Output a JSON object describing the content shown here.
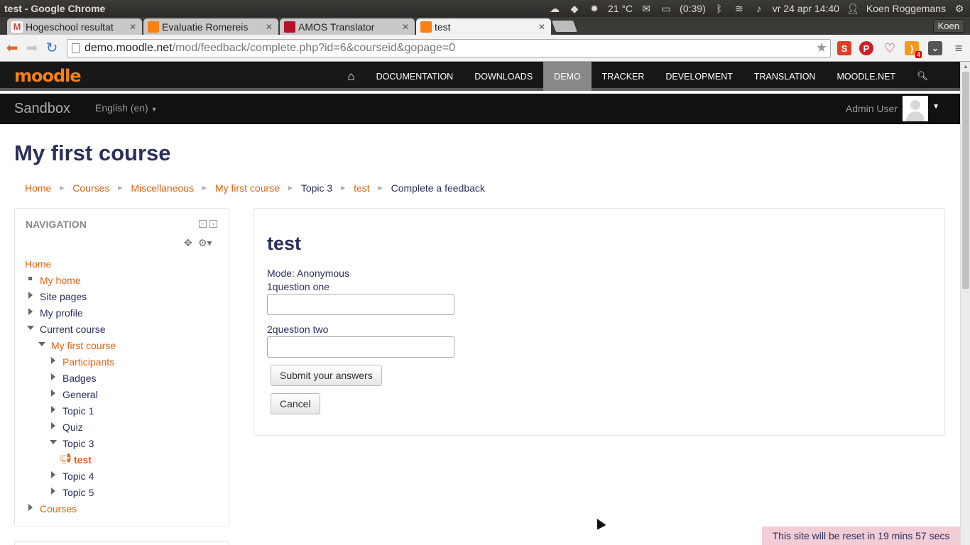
{
  "os_panel": {
    "window_title": "test - Google Chrome",
    "weather": "21 °C",
    "battery": "(0:39)",
    "datetime": "vr 24 apr 14:40",
    "user": "Koen Roggemans"
  },
  "browser": {
    "tabs": [
      {
        "label": "Hogeschool resultat",
        "favicon_color": "#d73b2f",
        "active": false
      },
      {
        "label": "Evaluatie Romereis",
        "favicon_color": "#f98012",
        "active": false
      },
      {
        "label": "AMOS Translator",
        "favicon_color": "#b5122a",
        "active": false
      },
      {
        "label": "test",
        "favicon_color": "#f98012",
        "active": true
      }
    ],
    "tab_close": "✕",
    "profile_name": "Koen",
    "url_host": "demo.moodle.net",
    "url_path": "/mod/feedback/complete.php?id=6&courseid&gopage=0",
    "rss_badge": "4"
  },
  "moodle": {
    "logo": "moodle",
    "top_nav": [
      "DOCUMENTATION",
      "DOWNLOADS",
      "DEMO",
      "TRACKER",
      "DEVELOPMENT",
      "TRANSLATION",
      "MOODLE.NET"
    ],
    "active_nav": "DEMO",
    "site_name": "Sandbox",
    "language": "English (en)",
    "user_name": "Admin User"
  },
  "page": {
    "title": "My first course",
    "breadcrumb": [
      {
        "label": "Home",
        "link": true
      },
      {
        "label": "Courses",
        "link": true
      },
      {
        "label": "Miscellaneous",
        "link": true
      },
      {
        "label": "My first course",
        "link": true
      },
      {
        "label": "Topic 3",
        "link": false
      },
      {
        "label": "test",
        "link": true
      },
      {
        "label": "Complete a feedback",
        "link": false
      }
    ]
  },
  "navigation": {
    "title": "NAVIGATION",
    "items": {
      "home": "Home",
      "my_home": "My home",
      "site_pages": "Site pages",
      "my_profile": "My profile",
      "current_course": "Current course",
      "my_first_course": "My first course",
      "participants": "Participants",
      "badges": "Badges",
      "general": "General",
      "topic1": "Topic 1",
      "quiz": "Quiz",
      "topic3": "Topic 3",
      "test": "test",
      "topic4": "Topic 4",
      "topic5": "Topic 5",
      "courses": "Courses"
    }
  },
  "feedback": {
    "title": "test",
    "mode": "Mode: Anonymous",
    "question1": "1question one",
    "question1_value": "",
    "question2": "2question two",
    "question2_value": "",
    "submit_label": "Submit your answers",
    "cancel_label": "Cancel"
  },
  "notice": "This site will be reset in 19 mins 57 secs",
  "colors": {
    "moodle_orange": "#f98012",
    "link": "#e2620f",
    "heading": "#2b2f5d",
    "notice_bg": "#f3cdd6"
  }
}
